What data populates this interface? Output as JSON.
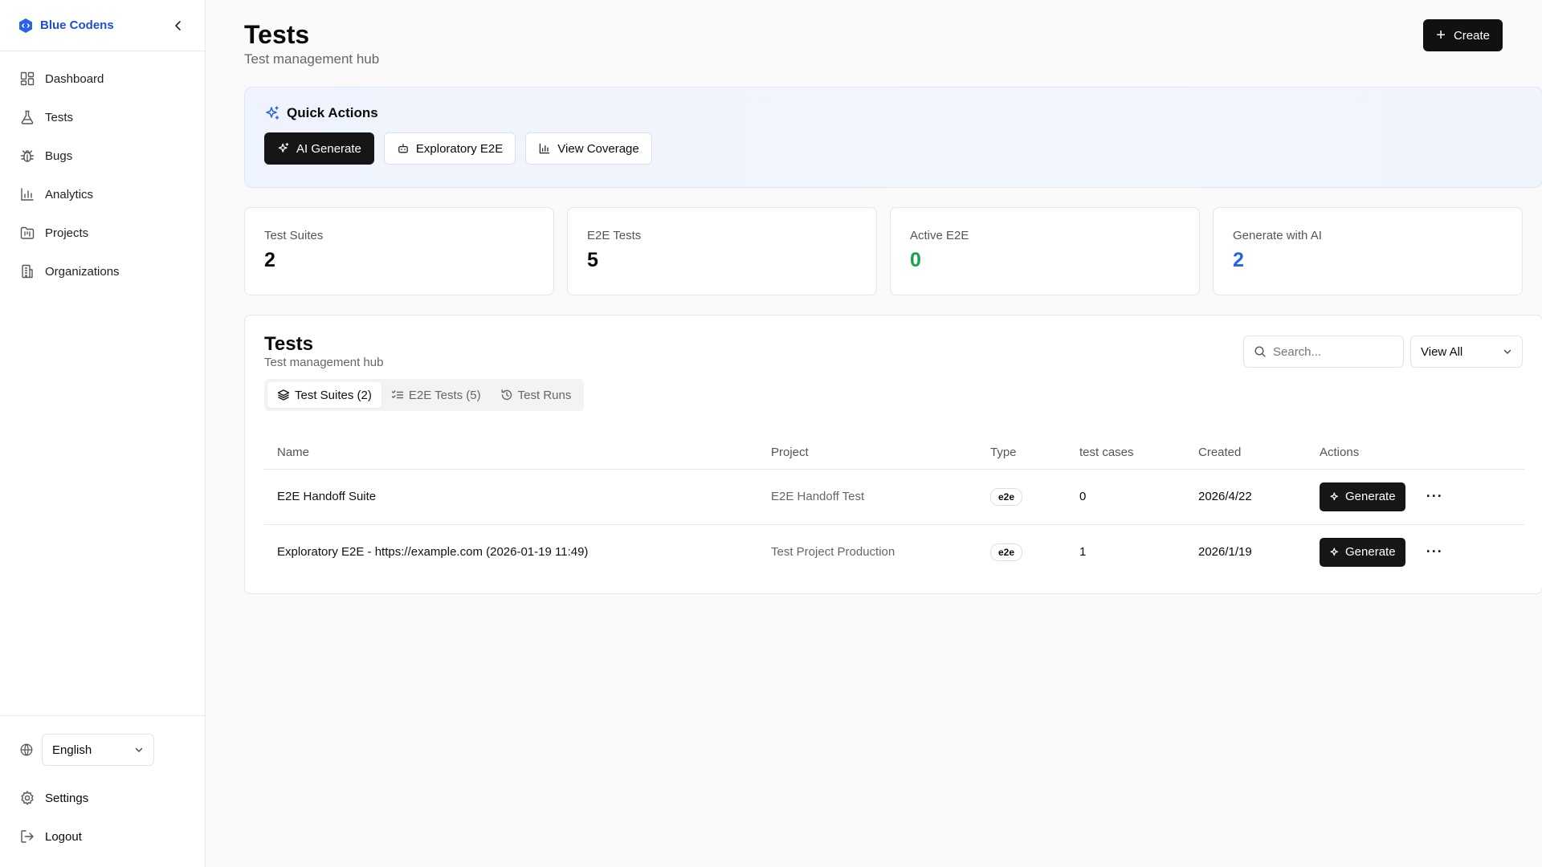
{
  "brand": {
    "name": "Blue Codens"
  },
  "sidebar": {
    "items": [
      {
        "label": "Dashboard",
        "icon": "dashboard-icon"
      },
      {
        "label": "Tests",
        "icon": "flask-icon"
      },
      {
        "label": "Bugs",
        "icon": "bug-icon"
      },
      {
        "label": "Analytics",
        "icon": "bar-chart-icon"
      },
      {
        "label": "Projects",
        "icon": "folder-kanban-icon"
      },
      {
        "label": "Organizations",
        "icon": "building-icon"
      }
    ],
    "language": "English",
    "settings_label": "Settings",
    "logout_label": "Logout"
  },
  "header": {
    "title": "Tests",
    "subtitle": "Test management hub",
    "create_label": "Create"
  },
  "quick_actions": {
    "title": "Quick Actions",
    "buttons": [
      {
        "label": "AI Generate",
        "icon": "sparkles-icon"
      },
      {
        "label": "Exploratory E2E",
        "icon": "bot-icon"
      },
      {
        "label": "View Coverage",
        "icon": "bar-chart-icon"
      }
    ]
  },
  "stats": [
    {
      "label": "Test Suites",
      "value": "2",
      "color": "#0a0a0a"
    },
    {
      "label": "E2E Tests",
      "value": "5",
      "color": "#0a0a0a"
    },
    {
      "label": "Active E2E",
      "value": "0",
      "color": "#16a34a"
    },
    {
      "label": "Generate with AI",
      "value": "2",
      "color": "#2563eb"
    }
  ],
  "panel": {
    "title": "Tests",
    "subtitle": "Test management hub",
    "search_placeholder": "Search...",
    "view_select": "View All",
    "tabs": [
      {
        "label": "Test Suites (2)",
        "icon": "layers-icon",
        "active": true
      },
      {
        "label": "E2E Tests (5)",
        "icon": "list-checks-icon",
        "active": false
      },
      {
        "label": "Test Runs",
        "icon": "history-icon",
        "active": false
      }
    ],
    "columns": [
      "Name",
      "Project",
      "Type",
      "test cases",
      "Created",
      "Actions"
    ],
    "rows": [
      {
        "name": "E2E Handoff Suite",
        "project": "E2E Handoff Test",
        "type": "e2e",
        "test_cases": "0",
        "created": "2026/4/22",
        "action": "Generate"
      },
      {
        "name": "Exploratory E2E - https://example.com (2026-01-19 11:49)",
        "project": "Test Project Production",
        "type": "e2e",
        "test_cases": "1",
        "created": "2026/1/19",
        "action": "Generate"
      }
    ]
  }
}
